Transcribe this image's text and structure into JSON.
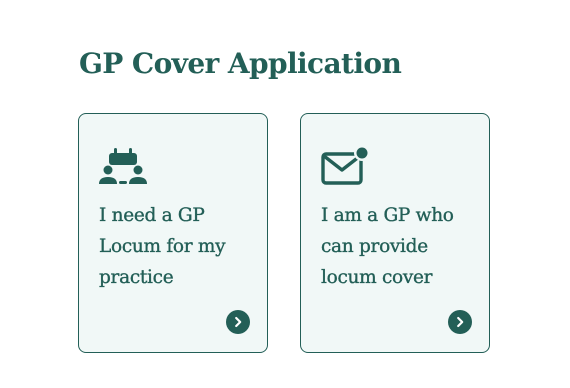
{
  "page": {
    "title": "GP Cover Application"
  },
  "options": [
    {
      "label": "I need a GP Locum for my practice",
      "icon": "people-calendar-icon"
    },
    {
      "label": "I am a GP who can provide locum cover",
      "icon": "mail-notification-icon"
    }
  ],
  "colors": {
    "accent": "#235f57",
    "card_background": "#f1f8f7",
    "page_background": "#ffffff"
  }
}
